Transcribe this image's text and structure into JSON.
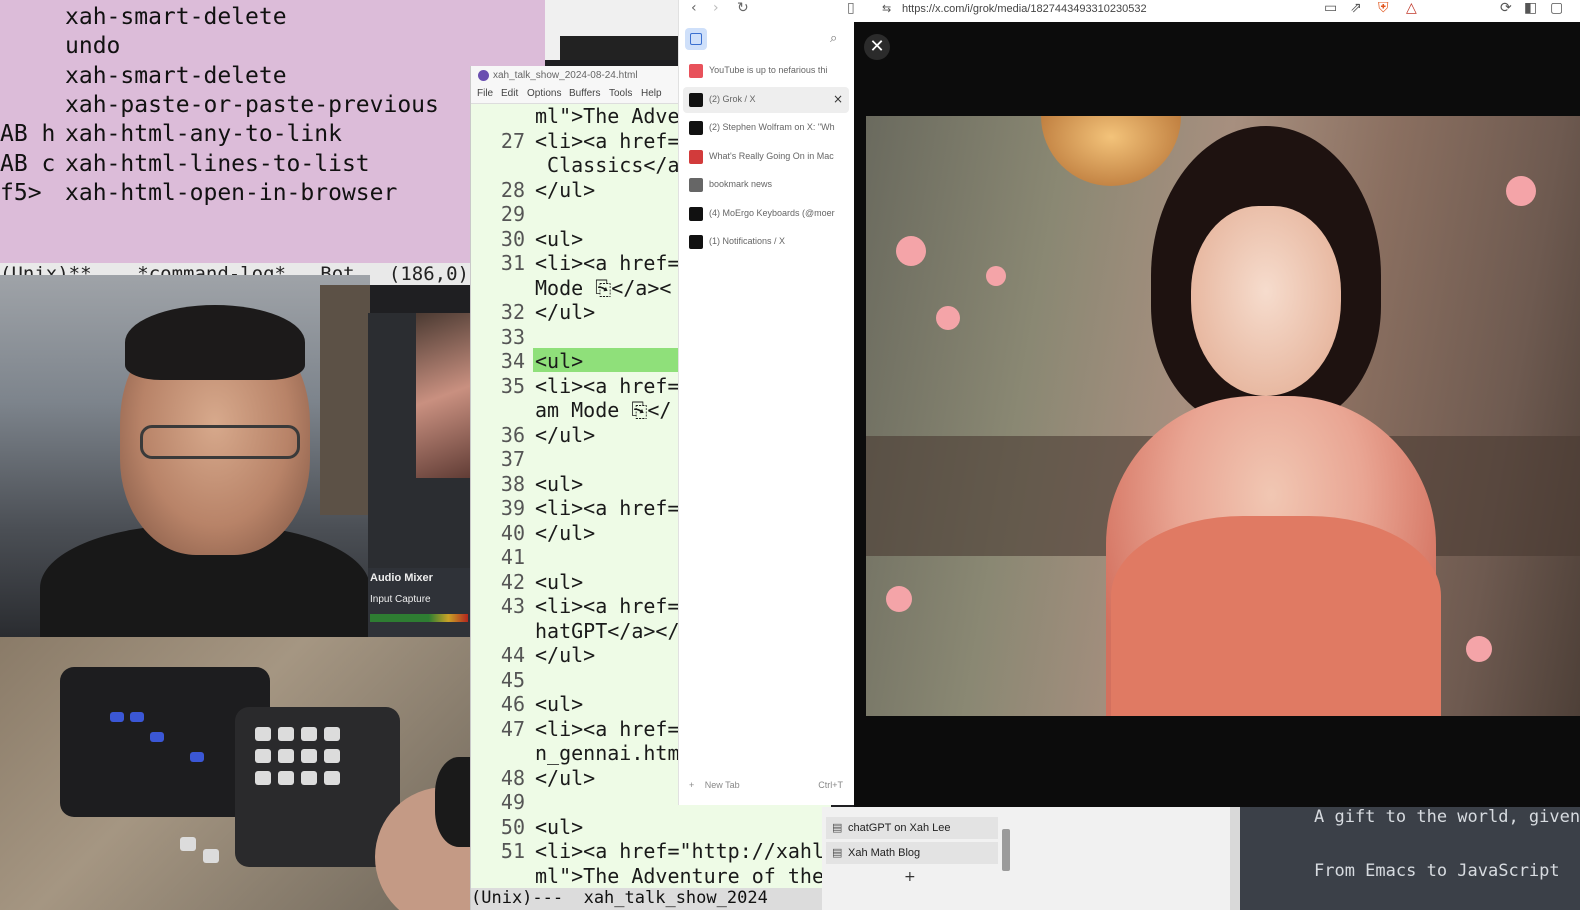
{
  "keymap": {
    "rows": [
      {
        "key": "",
        "cmd": "xah-smart-delete"
      },
      {
        "key": "",
        "cmd": "undo"
      },
      {
        "key": "",
        "cmd": "xah-smart-delete"
      },
      {
        "key": "",
        "cmd": "xah-paste-or-paste-previous"
      },
      {
        "key": "AB h",
        "cmd": "xah-html-any-to-link"
      },
      {
        "key": "AB c",
        "cmd": "xah-html-lines-to-list"
      },
      {
        "key": "f5>",
        "cmd": "xah-html-open-in-browser"
      }
    ],
    "modeline": "(Unix)**    *command-log*   Bot   (186,0)"
  },
  "editor": {
    "title": "xah_talk_show_2024-08-24.html",
    "menu": [
      "File",
      "Edit",
      "Options",
      "Buffers",
      "Tools",
      "Help"
    ],
    "lines": [
      {
        "n": "",
        "text": "ml\">The Adver"
      },
      {
        "n": "27",
        "text": "<li><a href='"
      },
      {
        "n": "",
        "text": " Classics</a"
      },
      {
        "n": "28",
        "text": "</ul>"
      },
      {
        "n": "29",
        "text": ""
      },
      {
        "n": "30",
        "text": "<ul>"
      },
      {
        "n": "31",
        "text": "<li><a href='"
      },
      {
        "n": "",
        "text": "Mode ⎘</a><"
      },
      {
        "n": "32",
        "text": "</ul>"
      },
      {
        "n": "33",
        "text": ""
      },
      {
        "n": "34",
        "text": "<ul>"
      },
      {
        "n": "35",
        "text": "<li><a href='"
      },
      {
        "n": "",
        "text": "am Mode ⎘</"
      },
      {
        "n": "36",
        "text": "</ul>"
      },
      {
        "n": "37",
        "text": ""
      },
      {
        "n": "38",
        "text": "<ul>"
      },
      {
        "n": "39",
        "text": "<li><a href='"
      },
      {
        "n": "40",
        "text": "</ul>"
      },
      {
        "n": "41",
        "text": ""
      },
      {
        "n": "42",
        "text": "<ul>"
      },
      {
        "n": "43",
        "text": "<li><a href='"
      },
      {
        "n": "",
        "text": "hatGPT</a></"
      },
      {
        "n": "44",
        "text": "</ul>"
      },
      {
        "n": "45",
        "text": ""
      },
      {
        "n": "46",
        "text": "<ul>"
      },
      {
        "n": "47",
        "text": "<li><a href='"
      },
      {
        "n": "",
        "text": "n_gennai.html"
      },
      {
        "n": "48",
        "text": "</ul>"
      },
      {
        "n": "49",
        "text": ""
      },
      {
        "n": "50",
        "text": "<ul>"
      },
      {
        "n": "51",
        "text": "<li><a href=\"http://xahle"
      },
      {
        "n": "",
        "text": "ml\">The Adventure of the"
      }
    ],
    "modeline": "(Unix)---  xah_talk_show_2024"
  },
  "obs": {
    "mixer_title": "Audio Mixer",
    "source": "Input Capture"
  },
  "tabs": {
    "items": [
      {
        "label": "YouTube is up to nefarious thi",
        "icon": "youtube-icon",
        "color": "#e8525b",
        "active": false
      },
      {
        "label": "(2) Grok / X",
        "icon": "x-icon",
        "color": "#111111",
        "active": true
      },
      {
        "label": "(2) Stephen Wolfram on X: \"Wh",
        "icon": "x-icon",
        "color": "#111111",
        "active": false
      },
      {
        "label": "What's Really Going On in Mac",
        "icon": "wolfram-icon",
        "color": "#d23b3b",
        "active": false
      },
      {
        "label": "bookmark news",
        "icon": "globe-icon",
        "color": "#666666",
        "active": false
      },
      {
        "label": "(4) MoErgo Keyboards (@moer",
        "icon": "x-icon",
        "color": "#111111",
        "active": false
      },
      {
        "label": "(1) Notifications / X",
        "icon": "x-icon",
        "color": "#111111",
        "active": false
      }
    ],
    "new_tab_label": "New Tab",
    "new_tab_shortcut": "Ctrl+T"
  },
  "browser": {
    "url": "https://x.com/i/grok/media/1827443493310230532"
  },
  "bookmarks": [
    {
      "label": "chatGPT on Xah Lee"
    },
    {
      "label": "Xah Math Blog"
    }
  ],
  "terminal": {
    "lines": [
      "A gift to the world, given",
      "",
      "From Emacs to JavaScript"
    ]
  }
}
